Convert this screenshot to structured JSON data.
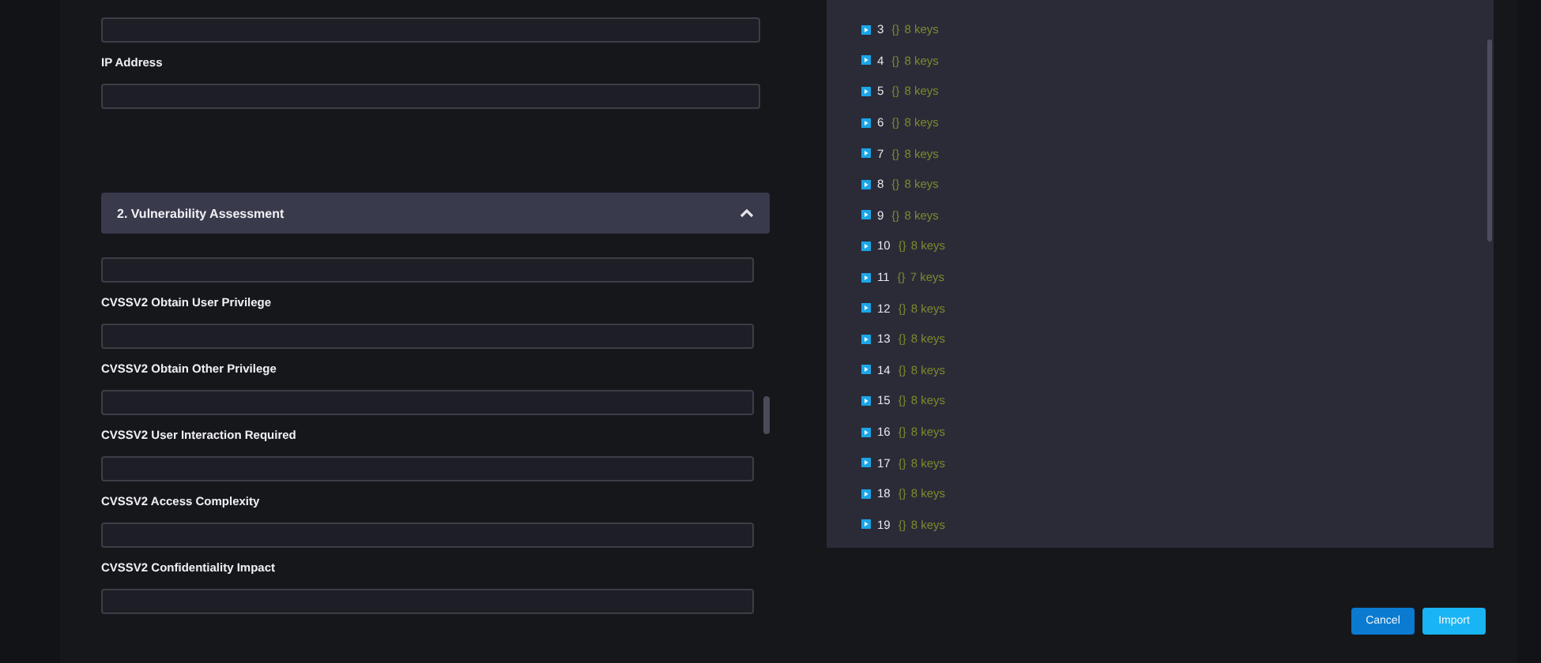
{
  "form": {
    "top_fields": [
      {
        "label": "IP Address"
      }
    ],
    "section": {
      "title": "2. Vulnerability Assessment",
      "expanded": true
    },
    "section_fields": [
      {
        "label": "CVSSV2 Obtain User Privilege"
      },
      {
        "label": "CVSSV2 Obtain Other Privilege"
      },
      {
        "label": "CVSSV2 User Interaction Required"
      },
      {
        "label": "CVSSV2 Access Complexity"
      },
      {
        "label": "CVSSV2 Confidentiality Impact"
      }
    ]
  },
  "json_tree": {
    "items": [
      {
        "key": "3",
        "brace": "{}",
        "summary": "8 keys",
        "expanded": false
      },
      {
        "key": "4",
        "brace": "{}",
        "summary": "8 keys",
        "expanded": false
      },
      {
        "key": "5",
        "brace": "{}",
        "summary": "8 keys",
        "expanded": false
      },
      {
        "key": "6",
        "brace": "{}",
        "summary": "8 keys",
        "expanded": false
      },
      {
        "key": "7",
        "brace": "{}",
        "summary": "8 keys",
        "expanded": false
      },
      {
        "key": "8",
        "brace": "{}",
        "summary": "8 keys",
        "expanded": false
      },
      {
        "key": "9",
        "brace": "{}",
        "summary": "8 keys",
        "expanded": false
      },
      {
        "key": "10",
        "brace": "{}",
        "summary": "8 keys",
        "expanded": false
      },
      {
        "key": "11",
        "brace": "{}",
        "summary": "7 keys",
        "expanded": false
      },
      {
        "key": "12",
        "brace": "{}",
        "summary": "8 keys",
        "expanded": false
      },
      {
        "key": "13",
        "brace": "{}",
        "summary": "8 keys",
        "expanded": false
      },
      {
        "key": "14",
        "brace": "{}",
        "summary": "8 keys",
        "expanded": false
      },
      {
        "key": "15",
        "brace": "{}",
        "summary": "8 keys",
        "expanded": false
      },
      {
        "key": "16",
        "brace": "{}",
        "summary": "8 keys",
        "expanded": false
      },
      {
        "key": "17",
        "brace": "{}",
        "summary": "8 keys",
        "expanded": false
      },
      {
        "key": "18",
        "brace": "{}",
        "summary": "8 keys",
        "expanded": false
      },
      {
        "key": "19",
        "brace": "{}",
        "summary": "8 keys",
        "expanded": false
      }
    ]
  },
  "buttons": [
    {
      "label": "Cancel",
      "kind": "secondary"
    },
    {
      "label": "Import",
      "kind": "primary"
    }
  ]
}
